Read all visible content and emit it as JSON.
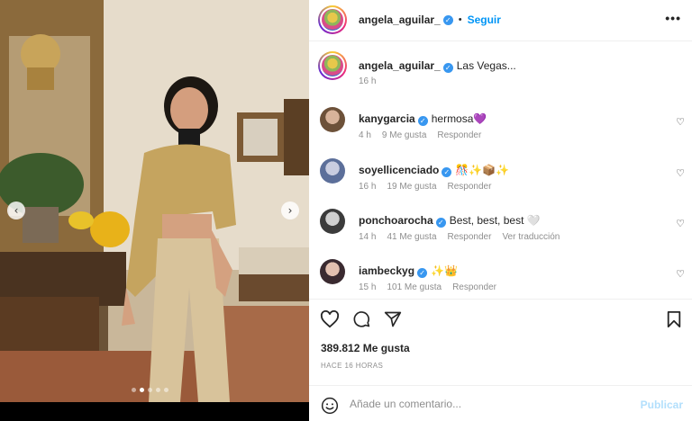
{
  "post": {
    "author": "angela_aguilar_",
    "follow_label": "Seguir",
    "separator": "•",
    "more_icon": "more-horizontal-icon",
    "caption": {
      "username": "angela_aguilar_",
      "text": "Las Vegas...",
      "time": "16 h"
    },
    "comments": [
      {
        "username": "kanygarcia",
        "text": "hermosa💜",
        "time": "4 h",
        "likes": "9 Me gusta",
        "reply": "Responder",
        "translate": ""
      },
      {
        "username": "soyellicenciado",
        "text": "🎊✨📦✨",
        "time": "16 h",
        "likes": "19 Me gusta",
        "reply": "Responder",
        "translate": ""
      },
      {
        "username": "ponchoarocha",
        "text": "Best, best, best 🤍",
        "time": "14 h",
        "likes": "41 Me gusta",
        "reply": "Responder",
        "translate": "Ver traducción"
      },
      {
        "username": "iambeckyg",
        "text": "✨👑",
        "time": "15 h",
        "likes": "101 Me gusta",
        "reply": "Responder",
        "translate": ""
      }
    ],
    "likes_count": "389.812 Me gusta",
    "time_ago": "HACE 16 HORAS",
    "comment_placeholder": "Añade un comentario...",
    "publish_label": "Publicar",
    "carousel": {
      "slides": 5,
      "active_index": 1
    }
  },
  "icons": {
    "like": "heart-icon",
    "comment": "comment-icon",
    "share": "send-icon",
    "save": "bookmark-icon",
    "emoji": "emoji-icon",
    "prev": "chevron-left-icon",
    "next": "chevron-right-icon",
    "verified": "verified-badge-icon"
  },
  "colors": {
    "accent": "#0095f6",
    "verified": "#3897f0",
    "publish_disabled": "#b2dffc",
    "muted": "#8e8e8e"
  }
}
